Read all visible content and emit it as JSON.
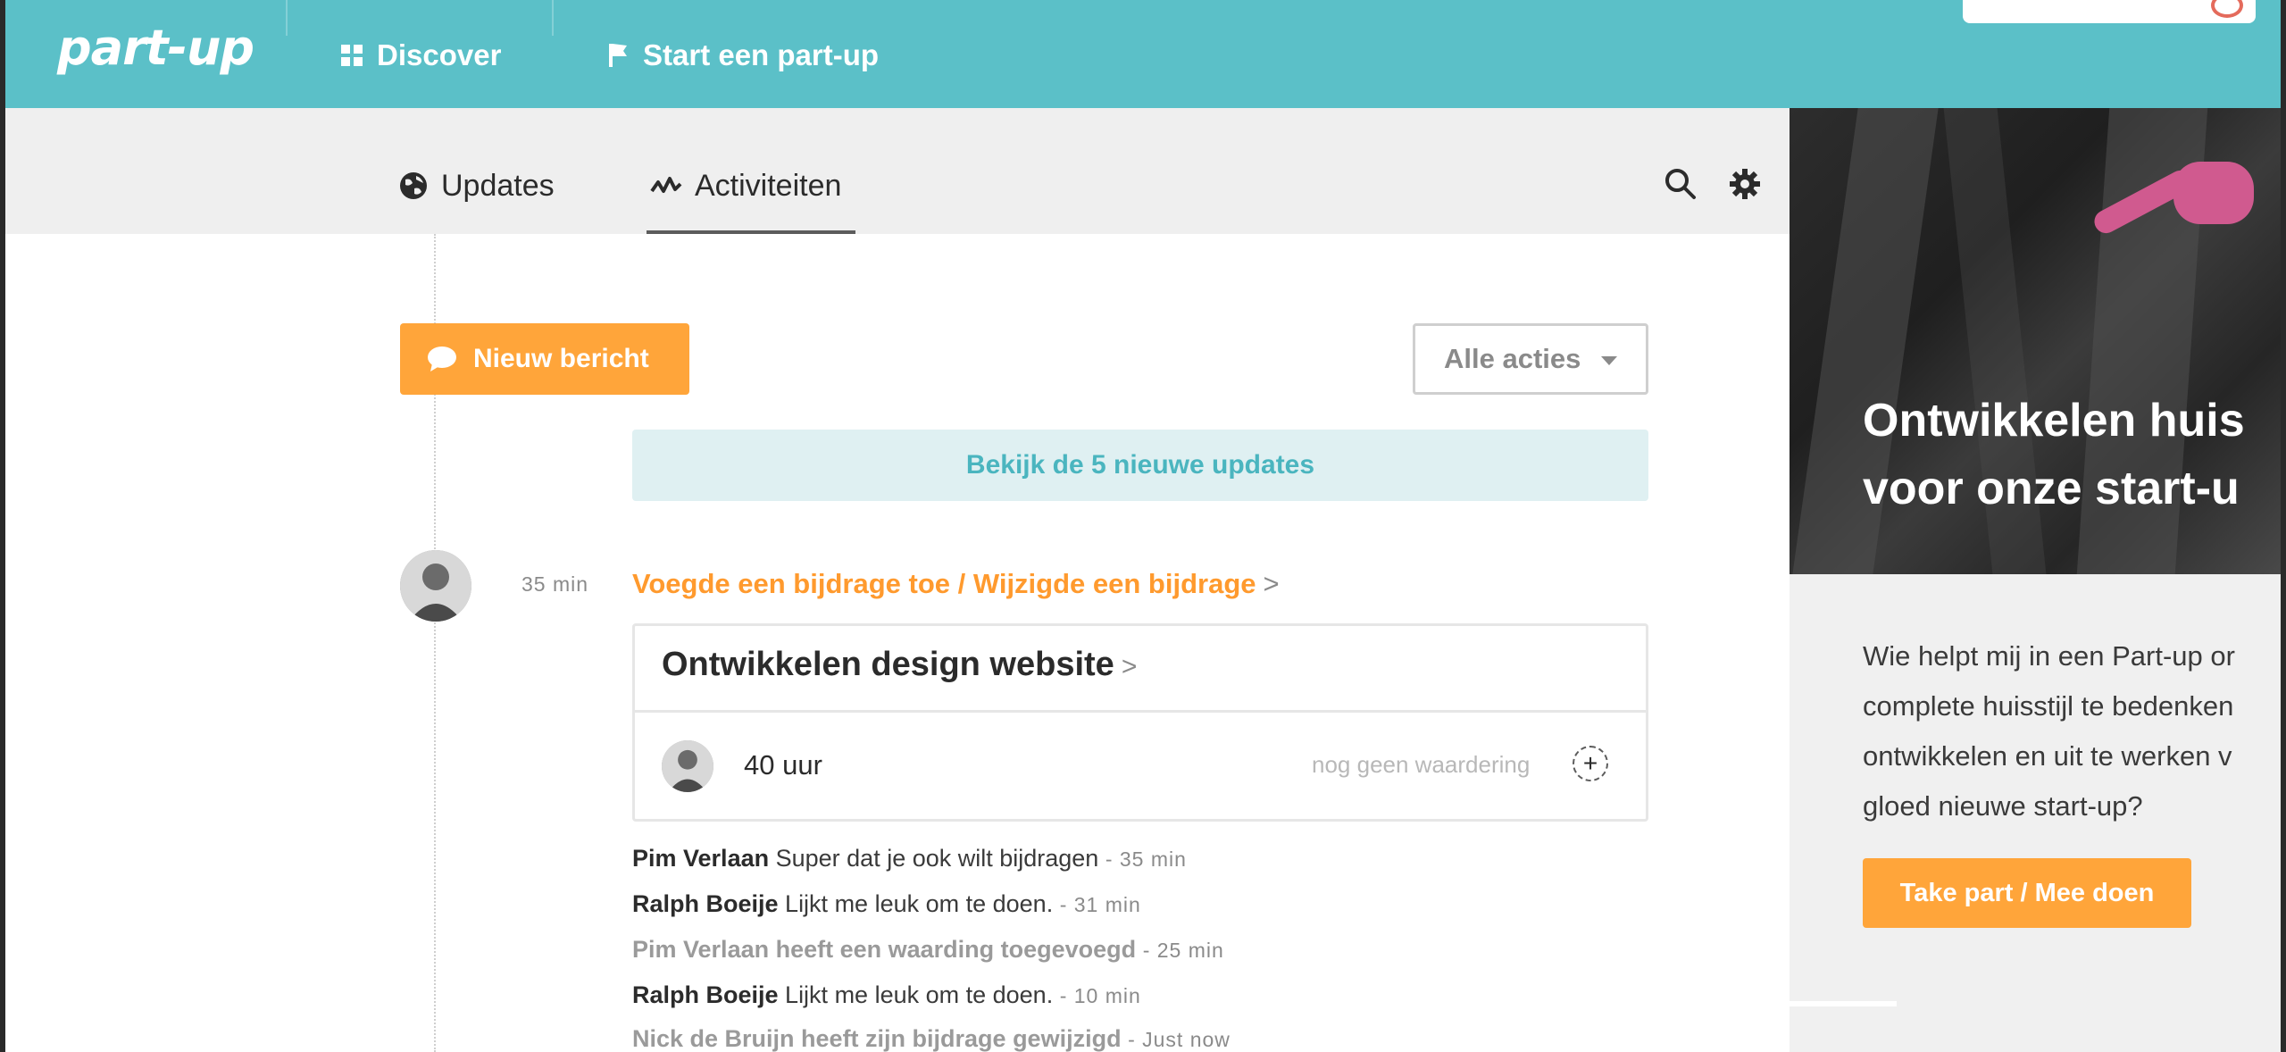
{
  "topnav": {
    "logo": "part-up",
    "items": [
      {
        "label": "Discover",
        "icon": "grid-icon"
      },
      {
        "label": "Start een part-up",
        "icon": "flag-icon"
      }
    ]
  },
  "subnav": {
    "tabs": [
      {
        "label": "Updates",
        "icon": "globe-icon"
      },
      {
        "label": "Activiteiten",
        "icon": "activity-icon",
        "active": true
      }
    ],
    "right_icons": [
      "search-icon",
      "gear-icon"
    ]
  },
  "feed": {
    "new_message_label": "Nieuw bericht",
    "filter_label": "Alle acties",
    "updates_banner": "Bekijk de 5 nieuwe updates",
    "activity": {
      "time": "35 min",
      "title": "Voegde een bijdrage toe / Wijzigde een bijdrage",
      "chevron": ">",
      "card": {
        "title": "Ontwikkelen design website",
        "chevron": ">",
        "hours": "40 uur",
        "rating": "nog geen waardering",
        "plus": "+"
      },
      "comments": [
        {
          "author": "Pim Verlaan",
          "text": "Super dat je ook wilt bijdragen",
          "time": "- 35 min"
        },
        {
          "author": "Ralph Boeije",
          "text": "Lijkt me leuk om te doen.",
          "time": "- 31 min"
        },
        {
          "event": "Pim Verlaan heeft een waarding toegevoegd",
          "time": "- 25 min"
        },
        {
          "author": "Ralph Boeije",
          "text": "Lijkt me leuk om te doen.",
          "time": "- 10 min"
        },
        {
          "event": "Nick de Bruijn heeft zijn bijdrage gewijzigd",
          "time": "- Just now"
        }
      ]
    }
  },
  "sidebar": {
    "hero_title_line1": "Ontwikkelen huis",
    "hero_title_line2": "voor onze start-u",
    "description_lines": [
      "Wie helpt mij in een Part-up or",
      "complete huisstijl te bedenken",
      "ontwikkelen en uit te werken v",
      "gloed nieuwe start-up?"
    ],
    "cta_label": "Take part / Mee doen"
  },
  "colors": {
    "brand_teal": "#5bc0c8",
    "accent_orange": "#ffa53a",
    "banner_bg": "#dff0f2"
  }
}
